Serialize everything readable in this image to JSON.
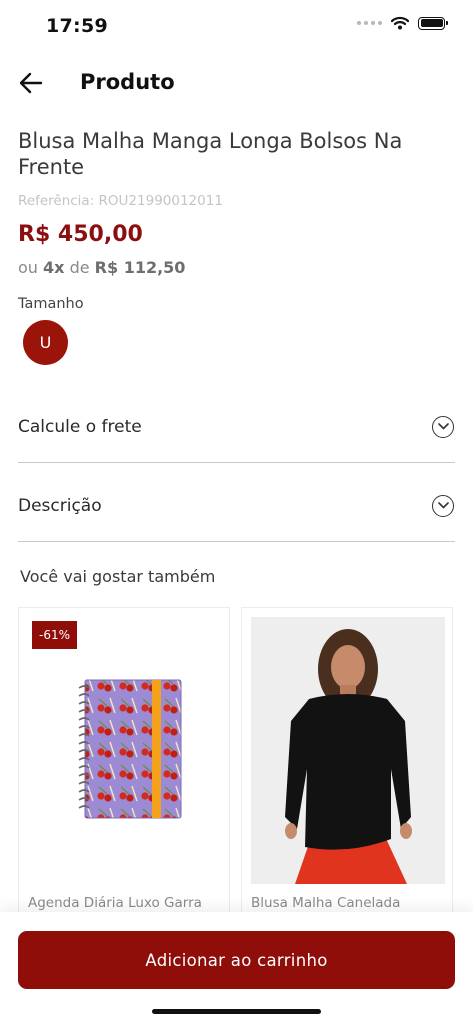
{
  "status_bar": {
    "time": "17:59"
  },
  "nav": {
    "title": "Produto"
  },
  "product": {
    "title": "Blusa Malha Manga Longa Bolsos Na Frente",
    "reference": "Referência: ROU21990012011",
    "price": "R$ 450,00",
    "installments": {
      "prefix": "ou",
      "count": "4x",
      "middle": "de",
      "value": "R$ 112,50"
    },
    "size_label": "Tamanho",
    "sizes": [
      "U"
    ]
  },
  "accordions": [
    {
      "label": "Calcule o frete",
      "icon": "chevron-down-circle-icon"
    },
    {
      "label": "Descrição",
      "icon": "chevron-down-circle-icon"
    }
  ],
  "recommendations": {
    "title": "Você vai gostar também",
    "items": [
      {
        "name": "Agenda Diária Luxo Garra",
        "badge": "-61%"
      },
      {
        "name": "Blusa Malha Canelada"
      }
    ]
  },
  "cart": {
    "button_label": "Adicionar ao carrinho"
  },
  "colors": {
    "brand": "#8f0e0a",
    "price": "#8b0f0f"
  }
}
